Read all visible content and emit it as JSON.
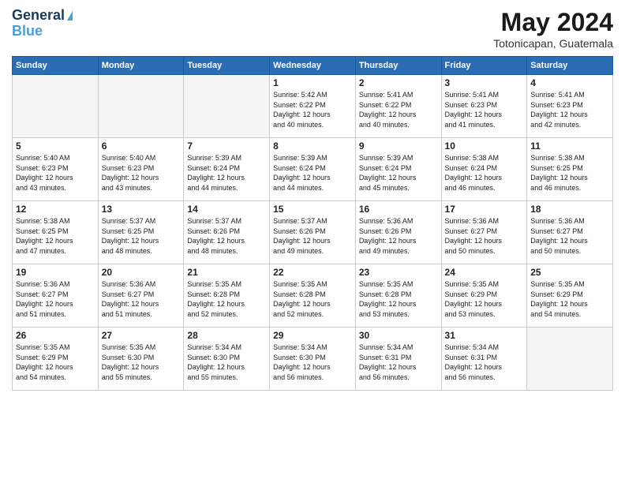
{
  "header": {
    "logo_line1": "General",
    "logo_line2": "Blue",
    "month_title": "May 2024",
    "location": "Totonicapan, Guatemala"
  },
  "days_of_week": [
    "Sunday",
    "Monday",
    "Tuesday",
    "Wednesday",
    "Thursday",
    "Friday",
    "Saturday"
  ],
  "weeks": [
    [
      {
        "num": "",
        "info": "",
        "empty": true
      },
      {
        "num": "",
        "info": "",
        "empty": true
      },
      {
        "num": "",
        "info": "",
        "empty": true
      },
      {
        "num": "1",
        "info": "Sunrise: 5:42 AM\nSunset: 6:22 PM\nDaylight: 12 hours\nand 40 minutes."
      },
      {
        "num": "2",
        "info": "Sunrise: 5:41 AM\nSunset: 6:22 PM\nDaylight: 12 hours\nand 40 minutes."
      },
      {
        "num": "3",
        "info": "Sunrise: 5:41 AM\nSunset: 6:23 PM\nDaylight: 12 hours\nand 41 minutes."
      },
      {
        "num": "4",
        "info": "Sunrise: 5:41 AM\nSunset: 6:23 PM\nDaylight: 12 hours\nand 42 minutes."
      }
    ],
    [
      {
        "num": "5",
        "info": "Sunrise: 5:40 AM\nSunset: 6:23 PM\nDaylight: 12 hours\nand 43 minutes."
      },
      {
        "num": "6",
        "info": "Sunrise: 5:40 AM\nSunset: 6:23 PM\nDaylight: 12 hours\nand 43 minutes."
      },
      {
        "num": "7",
        "info": "Sunrise: 5:39 AM\nSunset: 6:24 PM\nDaylight: 12 hours\nand 44 minutes."
      },
      {
        "num": "8",
        "info": "Sunrise: 5:39 AM\nSunset: 6:24 PM\nDaylight: 12 hours\nand 44 minutes."
      },
      {
        "num": "9",
        "info": "Sunrise: 5:39 AM\nSunset: 6:24 PM\nDaylight: 12 hours\nand 45 minutes."
      },
      {
        "num": "10",
        "info": "Sunrise: 5:38 AM\nSunset: 6:24 PM\nDaylight: 12 hours\nand 46 minutes."
      },
      {
        "num": "11",
        "info": "Sunrise: 5:38 AM\nSunset: 6:25 PM\nDaylight: 12 hours\nand 46 minutes."
      }
    ],
    [
      {
        "num": "12",
        "info": "Sunrise: 5:38 AM\nSunset: 6:25 PM\nDaylight: 12 hours\nand 47 minutes."
      },
      {
        "num": "13",
        "info": "Sunrise: 5:37 AM\nSunset: 6:25 PM\nDaylight: 12 hours\nand 48 minutes."
      },
      {
        "num": "14",
        "info": "Sunrise: 5:37 AM\nSunset: 6:26 PM\nDaylight: 12 hours\nand 48 minutes."
      },
      {
        "num": "15",
        "info": "Sunrise: 5:37 AM\nSunset: 6:26 PM\nDaylight: 12 hours\nand 49 minutes."
      },
      {
        "num": "16",
        "info": "Sunrise: 5:36 AM\nSunset: 6:26 PM\nDaylight: 12 hours\nand 49 minutes."
      },
      {
        "num": "17",
        "info": "Sunrise: 5:36 AM\nSunset: 6:27 PM\nDaylight: 12 hours\nand 50 minutes."
      },
      {
        "num": "18",
        "info": "Sunrise: 5:36 AM\nSunset: 6:27 PM\nDaylight: 12 hours\nand 50 minutes."
      }
    ],
    [
      {
        "num": "19",
        "info": "Sunrise: 5:36 AM\nSunset: 6:27 PM\nDaylight: 12 hours\nand 51 minutes."
      },
      {
        "num": "20",
        "info": "Sunrise: 5:36 AM\nSunset: 6:27 PM\nDaylight: 12 hours\nand 51 minutes."
      },
      {
        "num": "21",
        "info": "Sunrise: 5:35 AM\nSunset: 6:28 PM\nDaylight: 12 hours\nand 52 minutes."
      },
      {
        "num": "22",
        "info": "Sunrise: 5:35 AM\nSunset: 6:28 PM\nDaylight: 12 hours\nand 52 minutes."
      },
      {
        "num": "23",
        "info": "Sunrise: 5:35 AM\nSunset: 6:28 PM\nDaylight: 12 hours\nand 53 minutes."
      },
      {
        "num": "24",
        "info": "Sunrise: 5:35 AM\nSunset: 6:29 PM\nDaylight: 12 hours\nand 53 minutes."
      },
      {
        "num": "25",
        "info": "Sunrise: 5:35 AM\nSunset: 6:29 PM\nDaylight: 12 hours\nand 54 minutes."
      }
    ],
    [
      {
        "num": "26",
        "info": "Sunrise: 5:35 AM\nSunset: 6:29 PM\nDaylight: 12 hours\nand 54 minutes."
      },
      {
        "num": "27",
        "info": "Sunrise: 5:35 AM\nSunset: 6:30 PM\nDaylight: 12 hours\nand 55 minutes."
      },
      {
        "num": "28",
        "info": "Sunrise: 5:34 AM\nSunset: 6:30 PM\nDaylight: 12 hours\nand 55 minutes."
      },
      {
        "num": "29",
        "info": "Sunrise: 5:34 AM\nSunset: 6:30 PM\nDaylight: 12 hours\nand 56 minutes."
      },
      {
        "num": "30",
        "info": "Sunrise: 5:34 AM\nSunset: 6:31 PM\nDaylight: 12 hours\nand 56 minutes."
      },
      {
        "num": "31",
        "info": "Sunrise: 5:34 AM\nSunset: 6:31 PM\nDaylight: 12 hours\nand 56 minutes."
      },
      {
        "num": "",
        "info": "",
        "empty": true
      }
    ]
  ]
}
